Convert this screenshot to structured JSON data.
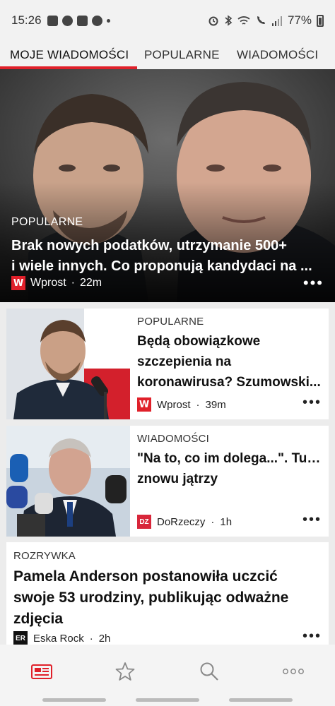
{
  "status_bar": {
    "time": "15:26",
    "battery": "77%"
  },
  "tabs": [
    {
      "label": "MOJE WIADOMOŚCI",
      "active": true
    },
    {
      "label": "POPULARNE",
      "active": false
    },
    {
      "label": "WIADOMOŚCI",
      "active": false
    }
  ],
  "hero": {
    "category": "POPULARNE",
    "title_line1": "Brak nowych podatków, utrzymanie 500+",
    "title_line2": "i wiele innych. Co proponują kandydaci na ...",
    "source": "Wprost",
    "time": "22m",
    "logo": "W",
    "more": "•••"
  },
  "articles": [
    {
      "category": "POPULARNE",
      "title_lines": [
        "Będą obowiązkowe",
        "szczepienia na",
        "koronawirusa? Szumowski..."
      ],
      "source": "Wprost",
      "time": "39m",
      "logo": "W",
      "more": "•••"
    },
    {
      "category": "WIADOMOŚCI",
      "title_lines": [
        "\"Na to, co im dolega...\". Tusk",
        "znowu jątrzy"
      ],
      "source": "DoRzeczy",
      "time": "1h",
      "logo": "DZ",
      "more": "•••"
    },
    {
      "category": "ROZRYWKA",
      "title_lines": [
        "Pamela Anderson postanowiła uczcić",
        "swoje 53 urodziny, publikując odważne",
        "zdjęcia"
      ],
      "source": "Eska Rock",
      "time": "2h",
      "logo": "ER",
      "more": "•••"
    }
  ],
  "bottom_nav": [
    {
      "icon": "news-icon",
      "active": true
    },
    {
      "icon": "star-icon",
      "active": false
    },
    {
      "icon": "search-icon",
      "active": false
    },
    {
      "icon": "more-icon",
      "active": false
    }
  ],
  "colors": {
    "accent": "#e0202a",
    "inactive_icon": "#888888"
  }
}
